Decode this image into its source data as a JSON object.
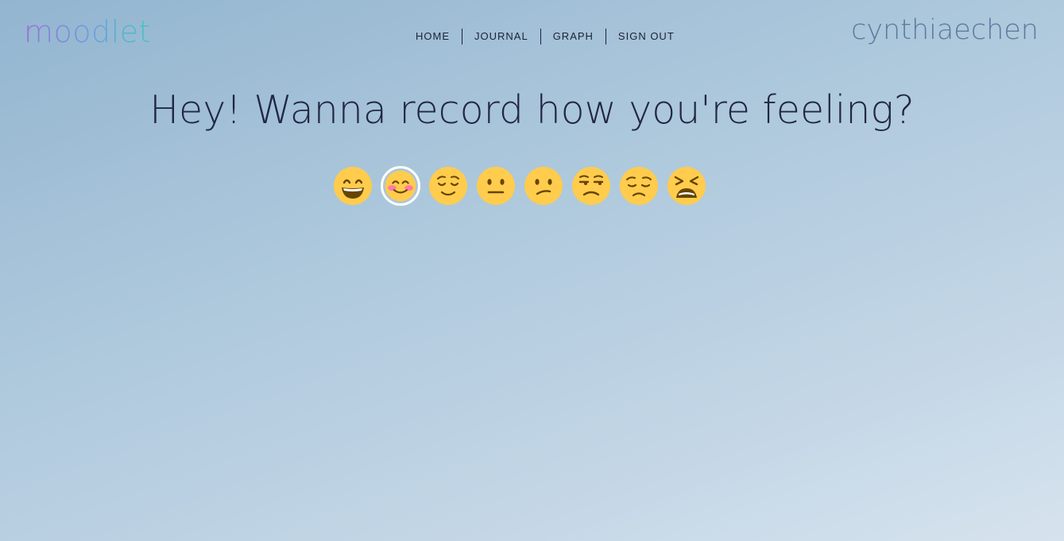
{
  "header": {
    "logo": "moodlet",
    "username": "cynthiaechen"
  },
  "nav": {
    "items": [
      {
        "label": "HOME"
      },
      {
        "label": "JOURNAL"
      },
      {
        "label": "GRAPH"
      },
      {
        "label": "SIGN OUT"
      }
    ]
  },
  "main": {
    "headline": "Hey! Wanna record how you're feeling?"
  },
  "moods": {
    "selected_index": 1,
    "items": [
      {
        "icon": "grinning-face-icon"
      },
      {
        "icon": "smiling-blushing-face-icon"
      },
      {
        "icon": "relieved-face-icon"
      },
      {
        "icon": "neutral-face-icon"
      },
      {
        "icon": "confused-face-icon"
      },
      {
        "icon": "unamused-face-icon"
      },
      {
        "icon": "pensive-face-icon"
      },
      {
        "icon": "tired-face-icon"
      }
    ]
  },
  "colors": {
    "emoji_yellow": "#ffcc4d",
    "emoji_feature": "#664500",
    "blush": "#ff7aa8",
    "selected_ring": "#ffffff"
  }
}
